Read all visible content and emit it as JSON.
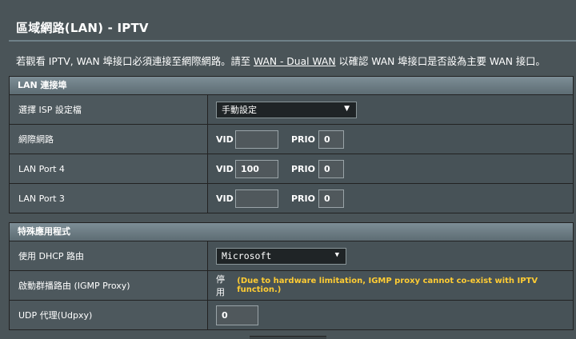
{
  "page": {
    "title": "區域網路(LAN) - IPTV",
    "description_prefix": "若觀看 IPTV, WAN 埠接口必須連接至網際網路。請至 ",
    "description_link": "WAN - Dual WAN",
    "description_suffix": " 以確認 WAN 埠接口是否設為主要 WAN 接口。"
  },
  "lan_port_section": {
    "header": "LAN 連接埠",
    "isp_profile": {
      "label": "選擇 ISP 設定檔",
      "value": "手動設定",
      "arrow": "▼"
    },
    "internet": {
      "label": "網際網路",
      "vid_label": "VID",
      "vid_value": "",
      "prio_label": "PRIO",
      "prio_value": "0"
    },
    "lan_port_4": {
      "label": "LAN Port 4",
      "vid_label": "VID",
      "vid_value": "100",
      "prio_label": "PRIO",
      "prio_value": "0"
    },
    "lan_port_3": {
      "label": "LAN Port 3",
      "vid_label": "VID",
      "vid_value": "",
      "prio_label": "PRIO",
      "prio_value": "0"
    }
  },
  "special_apps_section": {
    "header": "特殊應用程式",
    "dhcp_route": {
      "label": "使用 DHCP 路由",
      "value": "Microsoft",
      "arrow": "▼"
    },
    "igmp_proxy": {
      "label": "啟動群播路由 (IGMP Proxy)",
      "status": "停用",
      "warning": "(Due to hardware limitation, IGMP proxy cannot co-exist with IPTV function.)"
    },
    "udpxy": {
      "label": "UDP 代理(Udpxy)",
      "value": "0"
    }
  },
  "colors": {
    "background": "#4a5458",
    "section_header": "#6f7f86",
    "warning": "#ffcc33"
  }
}
